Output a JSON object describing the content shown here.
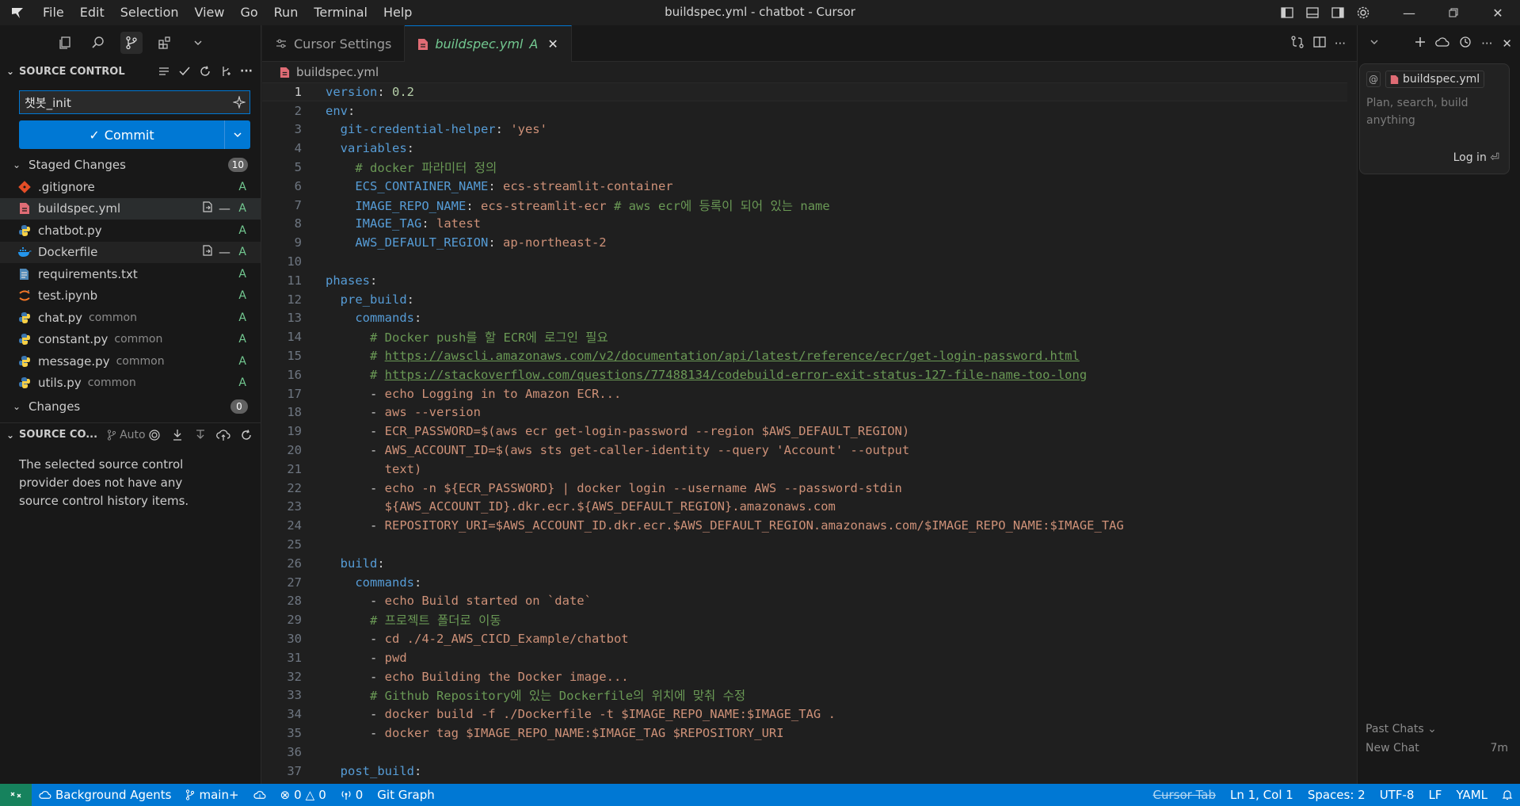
{
  "window": {
    "title": "buildspec.yml - chatbot - Cursor",
    "menu": [
      "File",
      "Edit",
      "Selection",
      "View",
      "Go",
      "Run",
      "Terminal",
      "Help"
    ]
  },
  "sidebar": {
    "section_title": "SOURCE CONTROL",
    "commit_message": "챗봇_init",
    "commit_label": "Commit",
    "staged": {
      "label": "Staged Changes",
      "count": "10",
      "files": [
        {
          "name": ".gitignore",
          "dir": "",
          "status": "A",
          "icon": "git-icon"
        },
        {
          "name": "buildspec.yml",
          "dir": "",
          "status": "A",
          "icon": "yaml-icon"
        },
        {
          "name": "chatbot.py",
          "dir": "",
          "status": "A",
          "icon": "python-icon"
        },
        {
          "name": "Dockerfile",
          "dir": "",
          "status": "A",
          "icon": "docker-icon"
        },
        {
          "name": "requirements.txt",
          "dir": "",
          "status": "A",
          "icon": "text-file-icon"
        },
        {
          "name": "test.ipynb",
          "dir": "",
          "status": "A",
          "icon": "jupyter-icon"
        },
        {
          "name": "chat.py",
          "dir": "common",
          "status": "A",
          "icon": "python-icon"
        },
        {
          "name": "constant.py",
          "dir": "common",
          "status": "A",
          "icon": "python-icon"
        },
        {
          "name": "message.py",
          "dir": "common",
          "status": "A",
          "icon": "python-icon"
        },
        {
          "name": "utils.py",
          "dir": "common",
          "status": "A",
          "icon": "python-icon"
        }
      ]
    },
    "changes": {
      "label": "Changes",
      "count": "0"
    },
    "graph": {
      "title": "SOURCE CO...",
      "auto_label": "Auto",
      "message": "The selected source control provider does not have any source control history items."
    }
  },
  "tabs": [
    {
      "label": "Cursor Settings",
      "icon": "settings-icon"
    },
    {
      "label": "buildspec.yml",
      "modified": "A",
      "icon": "yaml-icon"
    }
  ],
  "breadcrumb": {
    "file": "buildspec.yml"
  },
  "editor": {
    "current_line": 1,
    "lines": [
      [
        {
          "t": "version",
          "c": "k"
        },
        {
          "t": ": ",
          "c": "p"
        },
        {
          "t": "0.2",
          "c": "n"
        }
      ],
      [
        {
          "t": "env",
          "c": "k"
        },
        {
          "t": ":",
          "c": "p"
        }
      ],
      [
        {
          "t": "  git-credential-helper",
          "c": "k"
        },
        {
          "t": ": ",
          "c": "p"
        },
        {
          "t": "'yes'",
          "c": "s"
        }
      ],
      [
        {
          "t": "  variables",
          "c": "k"
        },
        {
          "t": ":",
          "c": "p"
        }
      ],
      [
        {
          "t": "    # docker 파라미터 정의",
          "c": "c"
        }
      ],
      [
        {
          "t": "    ECS_CONTAINER_NAME",
          "c": "k"
        },
        {
          "t": ": ",
          "c": "p"
        },
        {
          "t": "ecs-streamlit-container",
          "c": "t"
        }
      ],
      [
        {
          "t": "    IMAGE_REPO_NAME",
          "c": "k"
        },
        {
          "t": ": ",
          "c": "p"
        },
        {
          "t": "ecs-streamlit-ecr ",
          "c": "t"
        },
        {
          "t": "# aws ecr에 등록이 되어 있는 name",
          "c": "c"
        }
      ],
      [
        {
          "t": "    IMAGE_TAG",
          "c": "k"
        },
        {
          "t": ": ",
          "c": "p"
        },
        {
          "t": "latest",
          "c": "t"
        }
      ],
      [
        {
          "t": "    AWS_DEFAULT_REGION",
          "c": "k"
        },
        {
          "t": ": ",
          "c": "p"
        },
        {
          "t": "ap-northeast-2",
          "c": "t"
        }
      ],
      [],
      [
        {
          "t": "phases",
          "c": "k"
        },
        {
          "t": ":",
          "c": "p"
        }
      ],
      [
        {
          "t": "  pre_build",
          "c": "k"
        },
        {
          "t": ":",
          "c": "p"
        }
      ],
      [
        {
          "t": "    commands",
          "c": "k"
        },
        {
          "t": ":",
          "c": "p"
        }
      ],
      [
        {
          "t": "      # Docker push를 할 ECR에 로그인 필요",
          "c": "c"
        }
      ],
      [
        {
          "t": "      # ",
          "c": "c"
        },
        {
          "t": "https://awscli.amazonaws.com/v2/documentation/api/latest/reference/ecr/get-login-password.html",
          "c": "u"
        }
      ],
      [
        {
          "t": "      # ",
          "c": "c"
        },
        {
          "t": "https://stackoverflow.com/questions/77488134/codebuild-error-exit-status-127-file-name-too-long",
          "c": "u"
        }
      ],
      [
        {
          "t": "      - ",
          "c": "p"
        },
        {
          "t": "echo Logging in to Amazon ECR...",
          "c": "t"
        }
      ],
      [
        {
          "t": "      - ",
          "c": "p"
        },
        {
          "t": "aws --version",
          "c": "t"
        }
      ],
      [
        {
          "t": "      - ",
          "c": "p"
        },
        {
          "t": "ECR_PASSWORD=$(aws ecr get-login-password --region $AWS_DEFAULT_REGION)",
          "c": "t"
        }
      ],
      [
        {
          "t": "      - ",
          "c": "p"
        },
        {
          "t": "AWS_ACCOUNT_ID=$(aws sts get-caller-identity --query 'Account' --output",
          "c": "t"
        }
      ],
      [
        {
          "t": "        text)",
          "c": "t"
        }
      ],
      [
        {
          "t": "      - ",
          "c": "p"
        },
        {
          "t": "echo -n ${ECR_PASSWORD} | docker login --username AWS --password-stdin",
          "c": "t"
        }
      ],
      [
        {
          "t": "        ${AWS_ACCOUNT_ID}.dkr.ecr.${AWS_DEFAULT_REGION}.amazonaws.com",
          "c": "t"
        }
      ],
      [
        {
          "t": "      - ",
          "c": "p"
        },
        {
          "t": "REPOSITORY_URI=$AWS_ACCOUNT_ID.dkr.ecr.$AWS_DEFAULT_REGION.amazonaws.com/$IMAGE_REPO_NAME:$IMAGE_TAG",
          "c": "t"
        }
      ],
      [],
      [
        {
          "t": "  build",
          "c": "k"
        },
        {
          "t": ":",
          "c": "p"
        }
      ],
      [
        {
          "t": "    commands",
          "c": "k"
        },
        {
          "t": ":",
          "c": "p"
        }
      ],
      [
        {
          "t": "      - ",
          "c": "p"
        },
        {
          "t": "echo Build started on `date`",
          "c": "t"
        }
      ],
      [
        {
          "t": "      # 프로젝트 폴더로 이동",
          "c": "c"
        }
      ],
      [
        {
          "t": "      - ",
          "c": "p"
        },
        {
          "t": "cd ./4-2_AWS_CICD_Example/chatbot",
          "c": "t"
        }
      ],
      [
        {
          "t": "      - ",
          "c": "p"
        },
        {
          "t": "pwd",
          "c": "t"
        }
      ],
      [
        {
          "t": "      - ",
          "c": "p"
        },
        {
          "t": "echo Building the Docker image...",
          "c": "t"
        }
      ],
      [
        {
          "t": "      # Github Repository에 있는 Dockerfile의 위치에 맞춰 수정",
          "c": "c"
        }
      ],
      [
        {
          "t": "      - ",
          "c": "p"
        },
        {
          "t": "docker build -f ./Dockerfile -t $IMAGE_REPO_NAME:$IMAGE_TAG .",
          "c": "t"
        }
      ],
      [
        {
          "t": "      - ",
          "c": "p"
        },
        {
          "t": "docker tag $IMAGE_REPO_NAME:$IMAGE_TAG $REPOSITORY_URI",
          "c": "t"
        }
      ],
      [],
      [
        {
          "t": "  post_build",
          "c": "k"
        },
        {
          "t": ":",
          "c": "p"
        }
      ]
    ]
  },
  "chat": {
    "context_file": "buildspec.yml",
    "placeholder": "Plan, search, build anything",
    "login": "Log in",
    "past_chats": "Past Chats",
    "new_chat": "New Chat",
    "new_chat_time": "7m"
  },
  "statusbar": {
    "agents": "Background Agents",
    "branch": "main+",
    "errors": "0",
    "warnings": "0",
    "ports": "0",
    "git_graph": "Git Graph",
    "cursor_tab": "Cursor Tab",
    "position": "Ln 1, Col 1",
    "spaces": "Spaces: 2",
    "encoding": "UTF-8",
    "eol": "LF",
    "language": "YAML"
  },
  "colors": {
    "accent": "#0078d4",
    "added": "#73c991",
    "keyword": "#569cd6",
    "string": "#ce9178",
    "comment": "#6a9955"
  }
}
